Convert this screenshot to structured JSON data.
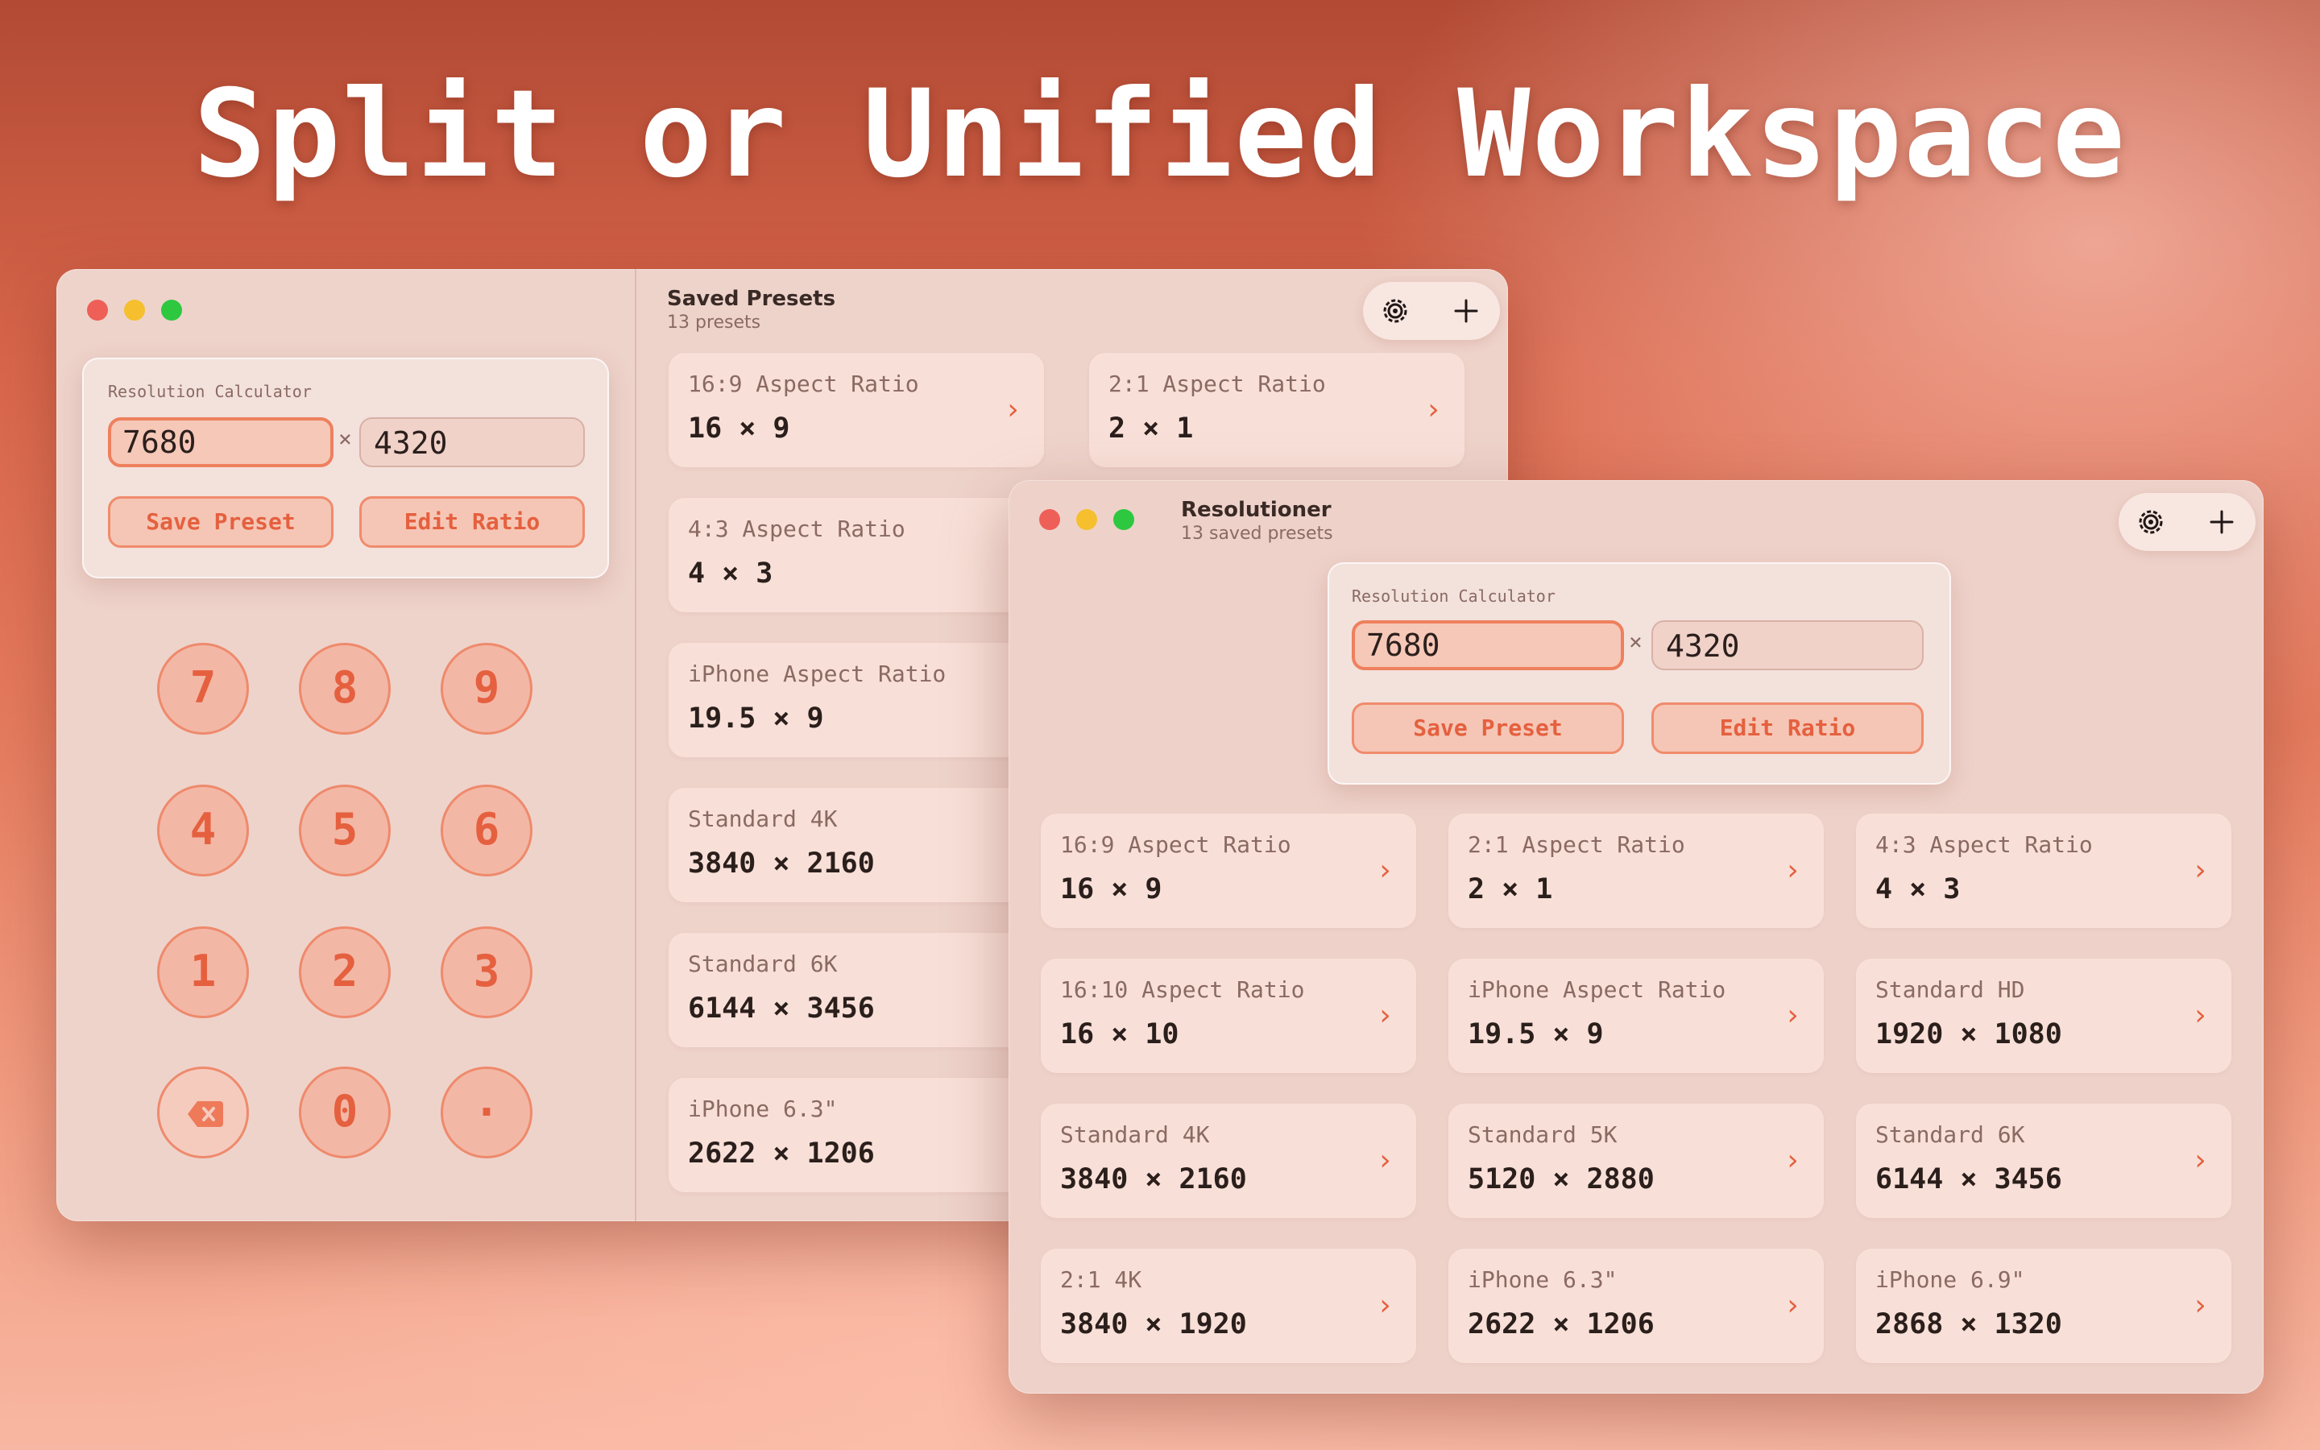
{
  "headline": "Split or Unified Workspace",
  "colors": {
    "accent": "#e5603f",
    "accent_border": "#ee805e",
    "window_bg": "#eed3cb",
    "card_bg": "#f8e0d8"
  },
  "icons": {
    "settings": "gear-icon",
    "add": "plus-icon",
    "delete": "backspace-icon",
    "chevron": "chevron-right-icon"
  },
  "split_window": {
    "calculator": {
      "label": "Resolution Calculator",
      "width_value": "7680",
      "height_value": "4320",
      "times_symbol": "×",
      "save_preset_label": "Save Preset",
      "edit_ratio_label": "Edit Ratio"
    },
    "keypad": [
      "7",
      "8",
      "9",
      "4",
      "5",
      "6",
      "1",
      "2",
      "3",
      "⌫",
      "0",
      "."
    ],
    "presets_title": "Saved Presets",
    "presets_subtitle": "13 presets",
    "presets": [
      {
        "name": "16:9 Aspect Ratio",
        "value": "16 × 9"
      },
      {
        "name": "2:1 Aspect Ratio",
        "value": "2 × 1"
      },
      {
        "name": "4:3 Aspect Ratio",
        "value": "4 × 3"
      },
      {
        "name": "iPhone Aspect Ratio",
        "value": "19.5 × 9"
      },
      {
        "name": "Standard 4K",
        "value": "3840 × 2160"
      },
      {
        "name": "Standard 6K",
        "value": "6144 × 3456"
      },
      {
        "name": "iPhone 6.3\"",
        "value": "2622 × 1206"
      }
    ]
  },
  "unified_window": {
    "title": "Resolutioner",
    "subtitle": "13 saved presets",
    "calculator": {
      "label": "Resolution Calculator",
      "width_value": "7680",
      "height_value": "4320",
      "times_symbol": "×",
      "save_preset_label": "Save Preset",
      "edit_ratio_label": "Edit Ratio"
    },
    "presets": [
      {
        "name": "16:9 Aspect Ratio",
        "value": "16 × 9"
      },
      {
        "name": "2:1 Aspect Ratio",
        "value": "2 × 1"
      },
      {
        "name": "4:3 Aspect Ratio",
        "value": "4 × 3"
      },
      {
        "name": "16:10 Aspect Ratio",
        "value": "16 × 10"
      },
      {
        "name": "iPhone Aspect Ratio",
        "value": "19.5 × 9"
      },
      {
        "name": "Standard HD",
        "value": "1920 × 1080"
      },
      {
        "name": "Standard 4K",
        "value": "3840 × 2160"
      },
      {
        "name": "Standard 5K",
        "value": "5120 × 2880"
      },
      {
        "name": "Standard 6K",
        "value": "6144 × 3456"
      },
      {
        "name": "2:1 4K",
        "value": "3840 × 1920"
      },
      {
        "name": "iPhone 6.3\"",
        "value": "2622 × 1206"
      },
      {
        "name": "iPhone 6.9\"",
        "value": "2868 × 1320"
      }
    ]
  }
}
